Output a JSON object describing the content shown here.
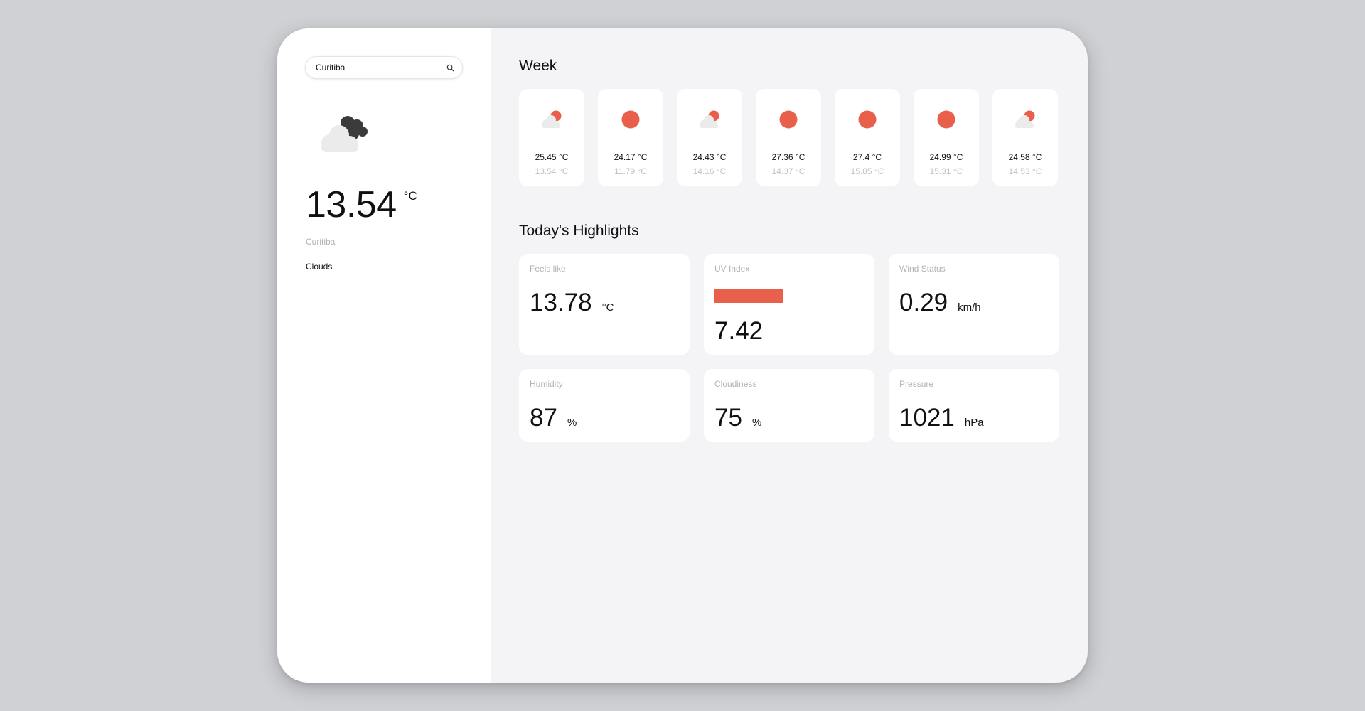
{
  "search": {
    "value": "Curitiba",
    "placeholder": ""
  },
  "current": {
    "icon": "cloud-icon",
    "temperature": "13.54",
    "unit": "°C",
    "city": "Curitiba",
    "condition": "Clouds"
  },
  "week": {
    "title": "Week",
    "days": [
      {
        "icon": "partly-cloudy-icon",
        "max": "25.45 °C",
        "min": "13.54 °C"
      },
      {
        "icon": "sun-icon",
        "max": "24.17 °C",
        "min": "11.79 °C"
      },
      {
        "icon": "partly-cloudy-icon",
        "max": "24.43 °C",
        "min": "14.16 °C"
      },
      {
        "icon": "sun-icon",
        "max": "27.36 °C",
        "min": "14.37 °C"
      },
      {
        "icon": "sun-icon",
        "max": "27.4 °C",
        "min": "15.85 °C"
      },
      {
        "icon": "sun-icon",
        "max": "24.99 °C",
        "min": "15.31 °C"
      },
      {
        "icon": "partly-cloudy-icon",
        "max": "24.58 °C",
        "min": "14.53 °C"
      }
    ]
  },
  "highlights": {
    "title": "Today's Highlights",
    "feels_like": {
      "label": "Feels like",
      "value": "13.78",
      "unit": "°C"
    },
    "uv_index": {
      "label": "UV Index",
      "value": "7.42",
      "level_percent": 62
    },
    "wind": {
      "label": "Wind Status",
      "value": "0.29",
      "unit": "km/h"
    },
    "humidity": {
      "label": "Humidity",
      "value": "87",
      "unit": "%"
    },
    "cloudiness": {
      "label": "Cloudiness",
      "value": "75",
      "unit": "%"
    },
    "pressure": {
      "label": "Pressure",
      "value": "1021",
      "unit": "hPa"
    }
  },
  "colors": {
    "accent": "#e8604b",
    "cloud_light": "#ebebeb",
    "cloud_dark": "#3b3b3b",
    "muted_text": "#b3b3b3",
    "panel_bg": "#f4f4f6",
    "page_bg": "#d0d1d5"
  }
}
